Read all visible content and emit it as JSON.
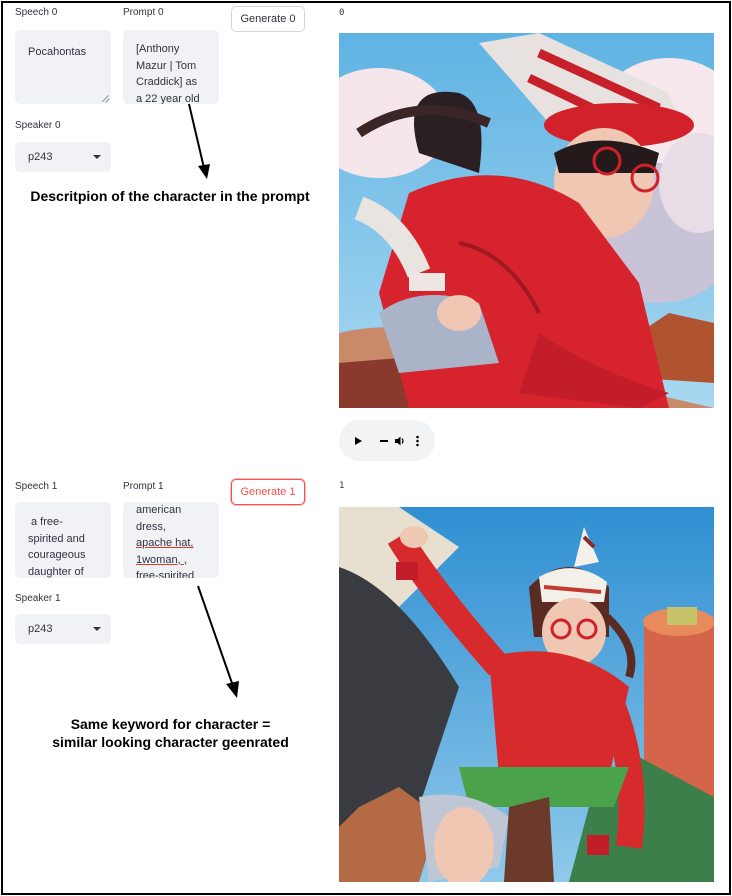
{
  "row0": {
    "speech_label": "Speech 0",
    "speech_value": "Pocahontas",
    "prompt_label": "Prompt 0",
    "prompt_lines": [
      "[Anthony",
      "Mazur | Tom",
      "Craddick] as",
      "a 22 year old"
    ],
    "generate_label": "Generate 0",
    "speaker_label": "Speaker 0",
    "speaker_value": "p243",
    "image_caption": "0"
  },
  "row1": {
    "speech_label": "Speech 1",
    "speech_lines": [
      "a free-",
      "spirited and",
      "courageous",
      "daughter of"
    ],
    "prompt_label": "Prompt 1",
    "prompt_lines": [
      "american",
      "dress,",
      "apache hat,",
      "1woman, ,",
      "free-spirited"
    ],
    "generate_label": "Generate 1",
    "speaker_label": "Speaker 1",
    "speaker_value": "p243",
    "image_caption": "1"
  },
  "annotations": {
    "top": "Descritpion of the character in the prompt",
    "bottom_line1": "Same keyword for character =",
    "bottom_line2": "similar looking character geenrated"
  },
  "icons": [
    "play-icon",
    "volume-icon",
    "more-options-icon"
  ],
  "colors": {
    "accent": "#ff4b4b",
    "widget_bg": "#f0f2f6"
  }
}
